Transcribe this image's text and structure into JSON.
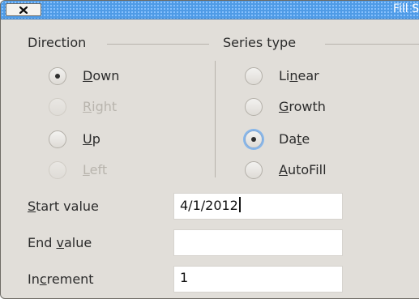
{
  "window": {
    "title": "Fill S"
  },
  "direction": {
    "title": "Direction",
    "options": [
      {
        "pre": "",
        "u": "D",
        "post": "own",
        "selected": true,
        "disabled": false
      },
      {
        "pre": "",
        "u": "R",
        "post": "ight",
        "selected": false,
        "disabled": true
      },
      {
        "pre": "",
        "u": "U",
        "post": "p",
        "selected": false,
        "disabled": false
      },
      {
        "pre": "",
        "u": "L",
        "post": "eft",
        "selected": false,
        "disabled": true
      }
    ]
  },
  "series_type": {
    "title": "Series type",
    "options": [
      {
        "pre": "Li",
        "u": "n",
        "post": "ear",
        "selected": false
      },
      {
        "pre": "",
        "u": "G",
        "post": "rowth",
        "selected": false
      },
      {
        "pre": "Da",
        "u": "t",
        "post": "e",
        "selected": true
      },
      {
        "pre": "",
        "u": "A",
        "post": "utoFill",
        "selected": false
      }
    ]
  },
  "fields": {
    "start": {
      "pre": "",
      "u": "S",
      "post": "tart value",
      "value": "4/1/2012"
    },
    "end": {
      "pre": "End ",
      "u": "v",
      "post": "alue",
      "value": ""
    },
    "increment": {
      "pre": "In",
      "u": "c",
      "post": "rement",
      "value": "1"
    }
  },
  "icons": {
    "close": "close-x-icon"
  }
}
